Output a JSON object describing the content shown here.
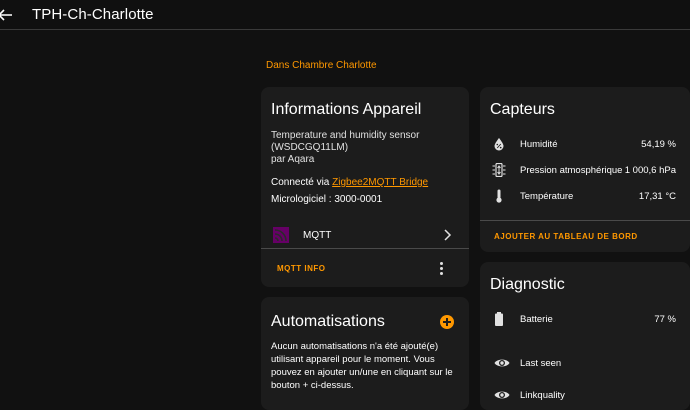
{
  "header": {
    "title": "TPH-Ch-Charlotte",
    "back_icon": "arrow-left-icon"
  },
  "area_link": "Dans Chambre Charlotte",
  "info_card": {
    "title": "Informations Appareil",
    "model_line1": "Temperature and humidity sensor",
    "model_line2": "(WSDCGQ11LM)",
    "manufacturer": "par Aqara",
    "connected_prefix": "Connecté via ",
    "connected_link": "Zigbee2MQTT Bridge",
    "firmware": "Micrologiciel : 3000-0001",
    "integration": {
      "label": "MQTT",
      "icon": "mqtt-icon"
    },
    "action": "MQTT INFO"
  },
  "automations_card": {
    "title": "Automatisations",
    "text": "Aucun automatisations n'a été ajouté(e) utilisant appareil pour le moment. Vous pouvez en ajouter un/une en cliquant sur le bouton + ci-dessus."
  },
  "sensors_card": {
    "title": "Capteurs",
    "rows": [
      {
        "name": "Humidité",
        "value": "54,19 %",
        "icon": "water-percent-icon"
      },
      {
        "name": "Pression atmosphérique",
        "value": "1 000,6 hPa",
        "icon": "gauge-icon"
      },
      {
        "name": "Température",
        "value": "17,31 °C",
        "icon": "thermometer-icon"
      }
    ],
    "action": "AJOUTER AU TABLEAU DE BORD"
  },
  "diagnostic_card": {
    "title": "Diagnostic",
    "rows": [
      {
        "name": "Batterie",
        "value": "77 %",
        "icon": "battery-icon"
      },
      {
        "name": "Last seen",
        "value": "",
        "icon": "eye-icon"
      },
      {
        "name": "Linkquality",
        "value": "",
        "icon": "eye-icon"
      }
    ]
  },
  "colors": {
    "accent": "#ff9800",
    "card": "#1c1c1c",
    "background": "#111111",
    "mqtt": "#660066"
  }
}
